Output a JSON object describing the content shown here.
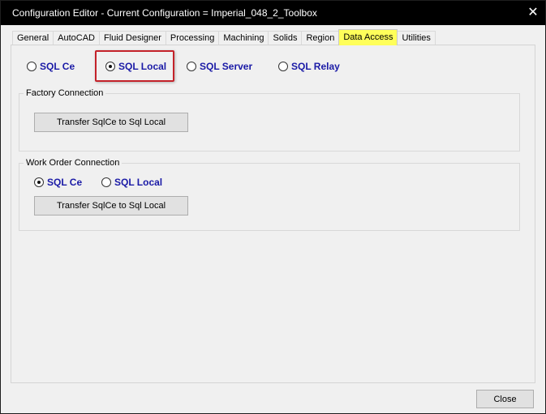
{
  "window": {
    "title": "Configuration Editor - Current Configuration = Imperial_048_2_Toolbox",
    "close_glyph": "✕"
  },
  "tabs": [
    {
      "label": "General"
    },
    {
      "label": "AutoCAD"
    },
    {
      "label": "Fluid Designer"
    },
    {
      "label": "Processing"
    },
    {
      "label": "Machining"
    },
    {
      "label": "Solids"
    },
    {
      "label": "Region"
    },
    {
      "label": "Data Access",
      "active": true
    },
    {
      "label": "Utilities"
    }
  ],
  "data_access": {
    "options": [
      {
        "label": "SQL Ce",
        "checked": false
      },
      {
        "label": "SQL Local",
        "checked": true
      },
      {
        "label": "SQL Server",
        "checked": false
      },
      {
        "label": "SQL Relay",
        "checked": false
      }
    ],
    "factory": {
      "title": "Factory Connection",
      "transfer_label": "Transfer SqlCe to Sql Local"
    },
    "work_order": {
      "title": "Work Order Connection",
      "options": [
        {
          "label": "SQL Ce",
          "checked": true
        },
        {
          "label": "SQL Local",
          "checked": false
        }
      ],
      "transfer_label": "Transfer SqlCe to Sql Local"
    }
  },
  "footer": {
    "close_label": "Close"
  },
  "colors": {
    "titlebar": "#000000",
    "active_tab": "#ffff5a",
    "radio_label": "#1a1aa6",
    "highlight": "#c4222a"
  },
  "icons": {
    "close": "close-icon"
  }
}
